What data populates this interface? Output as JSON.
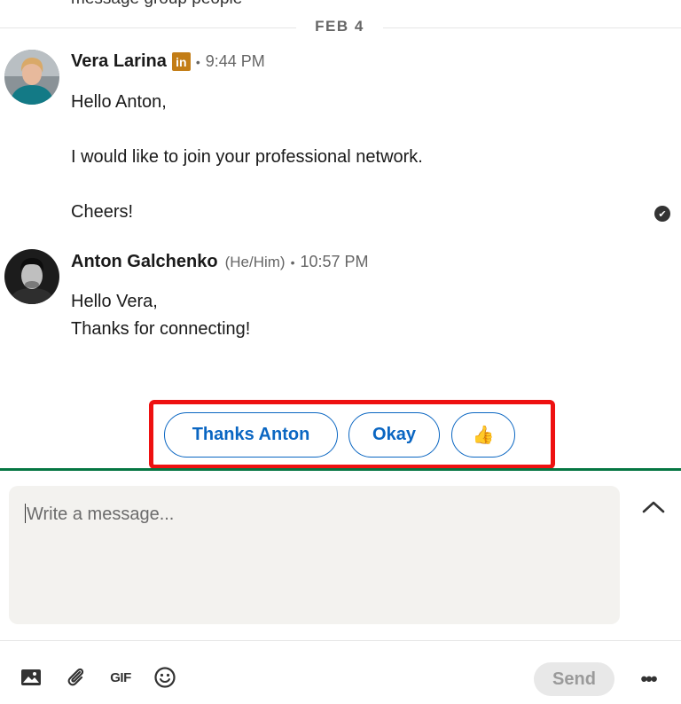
{
  "date_divider": "FEB 4",
  "prev_message_fragment": "message group people",
  "messages": [
    {
      "sender": "Vera Larina",
      "badge": "in",
      "dot": "•",
      "time": "9:44 PM",
      "lines": [
        "Hello Anton,",
        "I would like to join your professional network.",
        "Cheers!"
      ],
      "avatar_icon": "profile-photo-vera"
    },
    {
      "sender": "Anton Galchenko",
      "pronouns": "(He/Him)",
      "dot": "•",
      "time": "10:57 PM",
      "lines": [
        "Hello Vera,",
        "Thanks for connecting!"
      ],
      "avatar_icon": "profile-photo-anton"
    }
  ],
  "read_receipt_icon": "check-circle-icon",
  "suggested_replies": [
    "Thanks Anton",
    "Okay",
    "👍"
  ],
  "highlight_color": "#ee1111",
  "composer": {
    "placeholder": "Write a message...",
    "expand_icon": "chevron-up-icon"
  },
  "toolbar": {
    "icons": [
      "image-icon",
      "paperclip-icon",
      "gif-icon",
      "emoji-icon"
    ],
    "gif_label": "GIF",
    "send_label": "Send",
    "more_label": "•••"
  },
  "colors": {
    "accent": "#0a66c2",
    "active_border": "#057642",
    "linkedin_badge": "#c37d16"
  }
}
